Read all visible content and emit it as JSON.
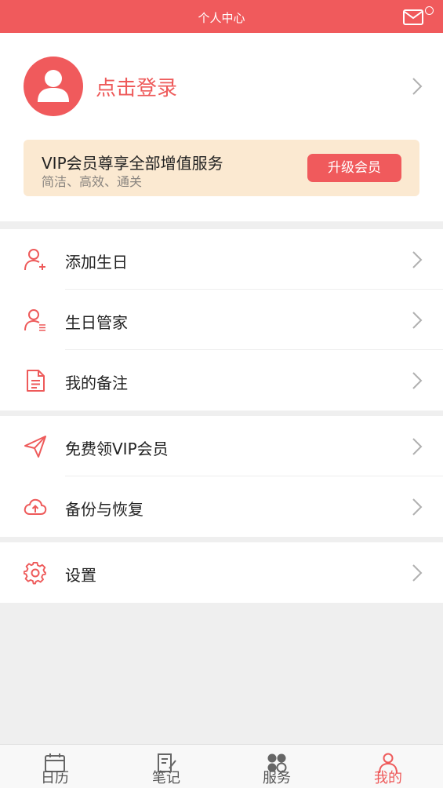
{
  "header": {
    "title": "个人中心",
    "icon": "mail-icon"
  },
  "profile": {
    "login_label": "点击登录",
    "avatar_icon": "user-avatar-icon"
  },
  "vip": {
    "title": "VIP会员尊享全部增值服务",
    "subtitle": "简洁、高效、通关",
    "button": "升级会员"
  },
  "groups": [
    {
      "items": [
        {
          "label": "添加生日",
          "icon": "add-user-icon"
        },
        {
          "label": "生日管家",
          "icon": "user-list-icon"
        },
        {
          "label": "我的备注",
          "icon": "document-icon"
        }
      ]
    },
    {
      "items": [
        {
          "label": "免费领VIP会员",
          "icon": "paper-plane-icon"
        },
        {
          "label": "备份与恢复",
          "icon": "cloud-upload-icon"
        }
      ]
    },
    {
      "items": [
        {
          "label": "设置",
          "icon": "gear-icon"
        }
      ]
    }
  ],
  "tabs": [
    {
      "label": "日历",
      "icon": "calendar-icon",
      "active": false
    },
    {
      "label": "笔记",
      "icon": "note-icon",
      "active": false
    },
    {
      "label": "服务",
      "icon": "grid-icon",
      "active": false
    },
    {
      "label": "我的",
      "icon": "user-icon",
      "active": true
    }
  ],
  "colors": {
    "accent": "#f05a5c",
    "vip_bg": "#fbe9d1",
    "page_bg": "#efefef"
  }
}
